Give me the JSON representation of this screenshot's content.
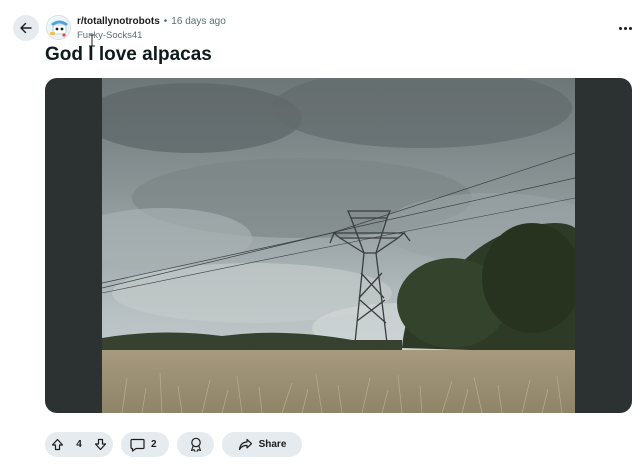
{
  "post": {
    "subreddit": "r/totallynotrobots",
    "separator": "•",
    "time_ago": "16 days ago",
    "author": "Funky-Socks41",
    "title": "God I love alpacas"
  },
  "icons": {
    "back": "arrow-left-icon",
    "more": "more-horizontal-icon",
    "upvote": "arrow-up-icon",
    "downvote": "arrow-down-icon",
    "comments": "comment-bubble-icon",
    "award": "award-icon",
    "share": "share-arrow-icon"
  },
  "actions": {
    "vote_count": "4",
    "comment_count": "2",
    "share_label": "Share"
  },
  "colors": {
    "pill_bg": "#e5ebee",
    "meta_text": "#576f76",
    "media_bg": "#2c3131"
  }
}
